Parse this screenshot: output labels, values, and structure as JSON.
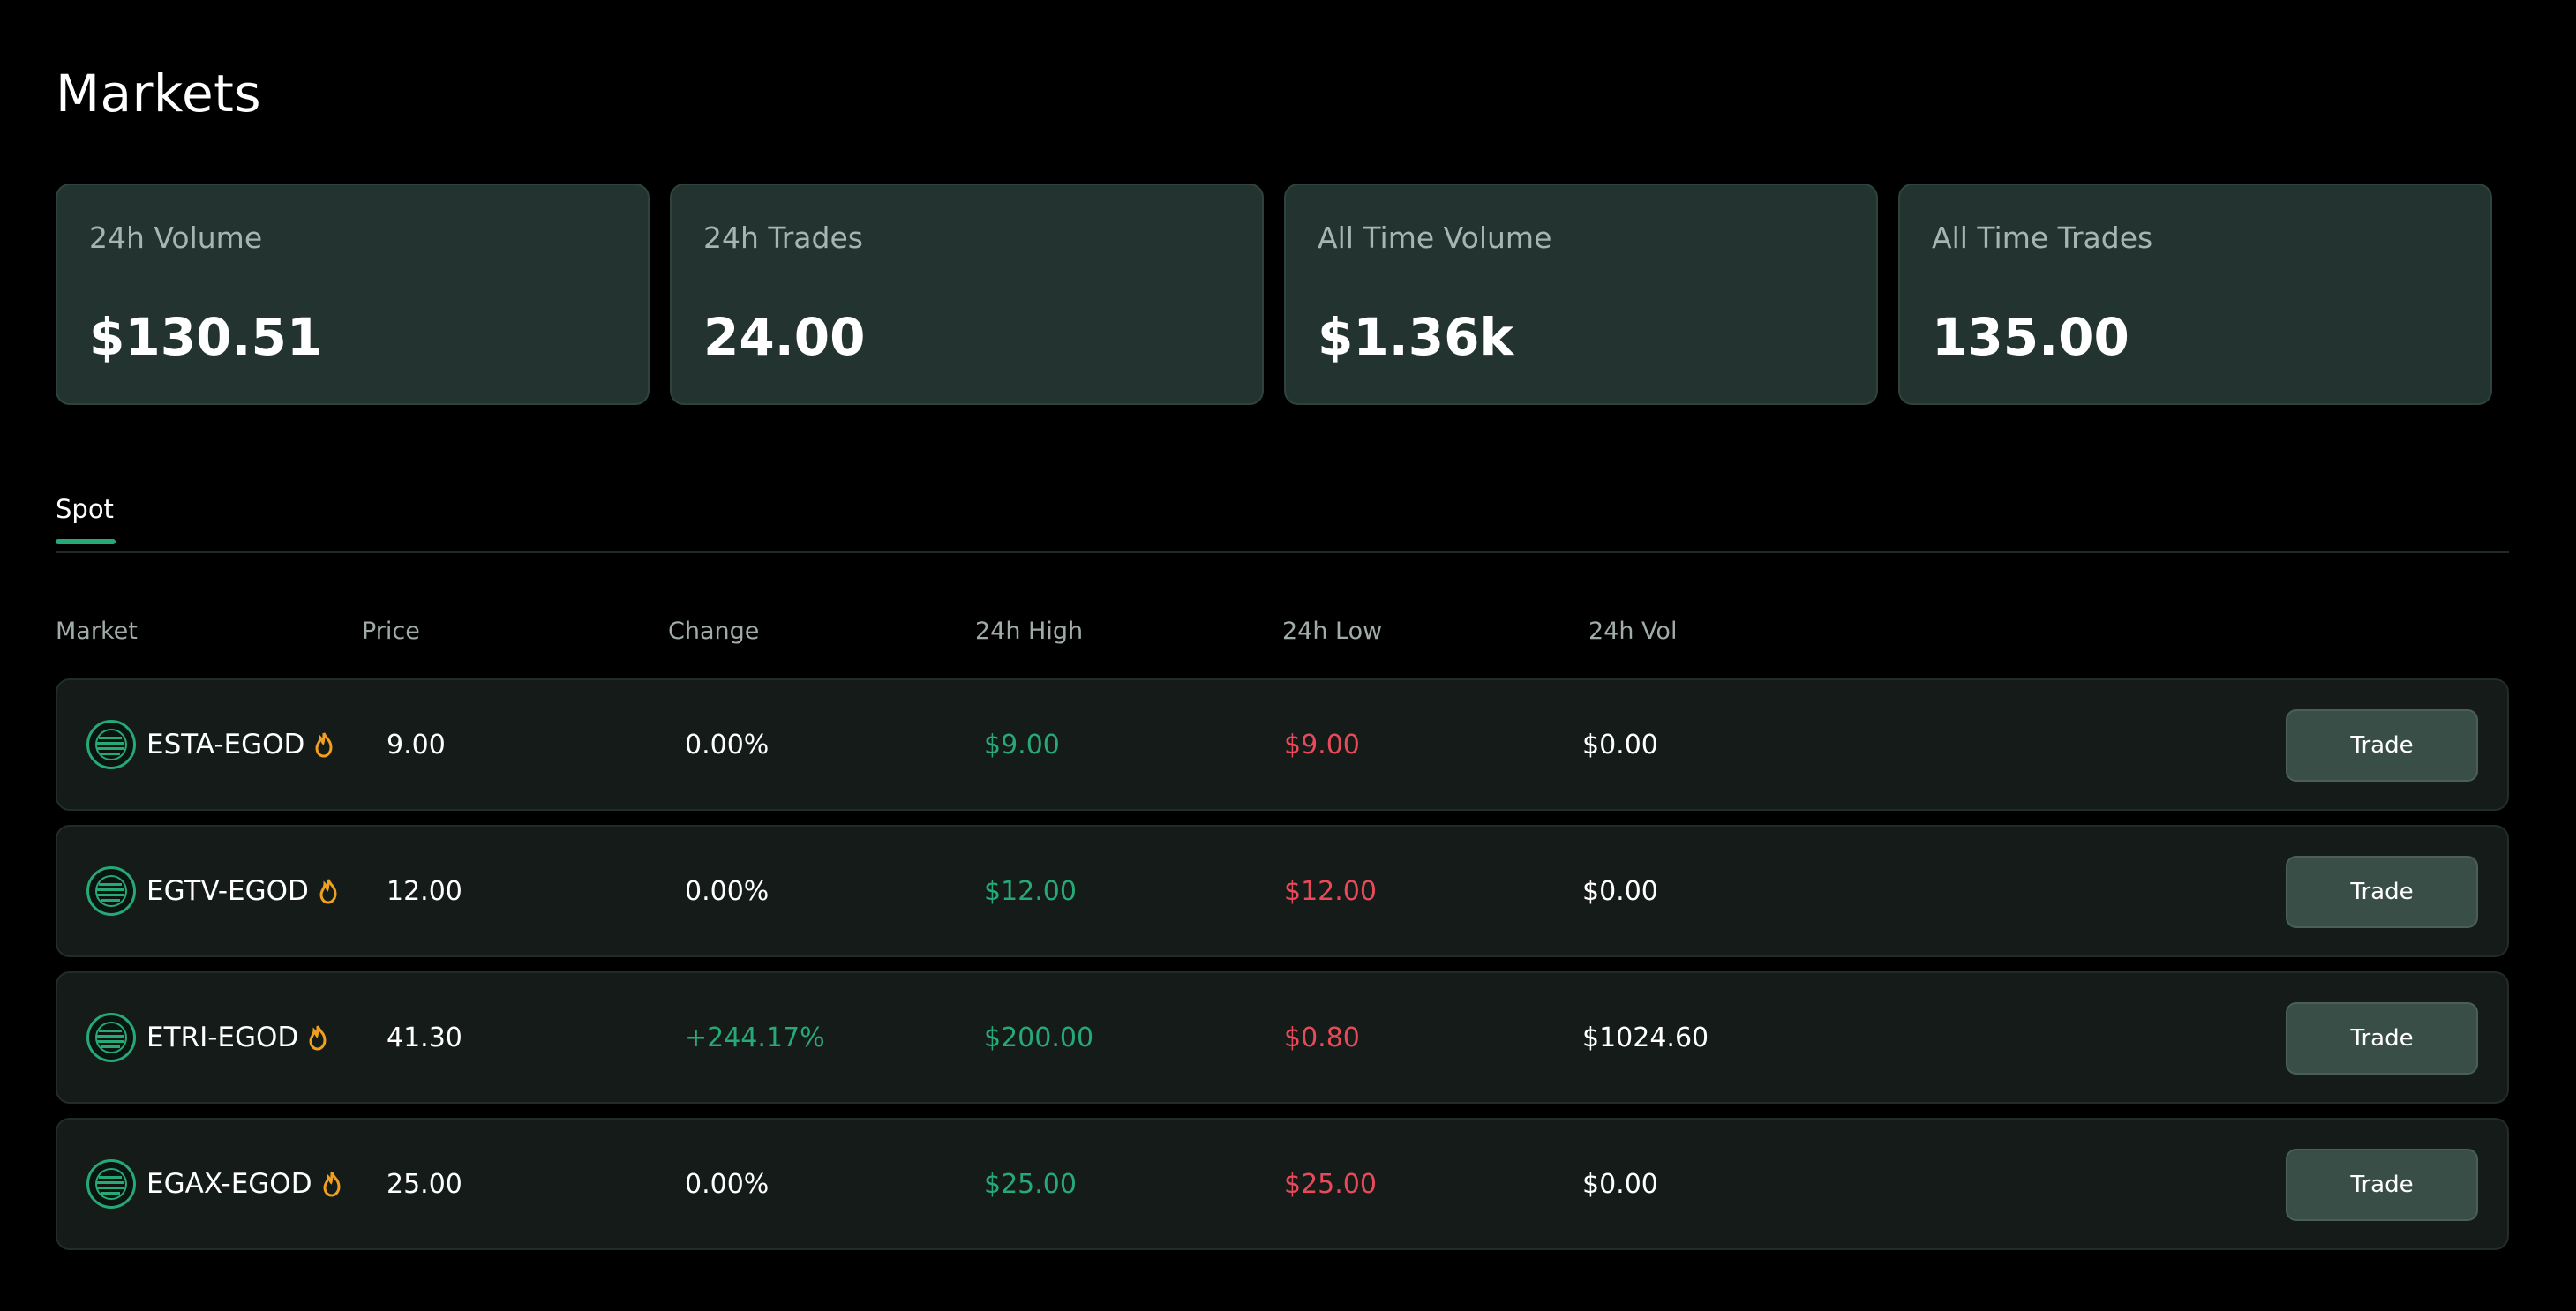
{
  "page": {
    "title": "Markets"
  },
  "stats": [
    {
      "label": "24h Volume",
      "value": "$130.51"
    },
    {
      "label": "24h Trades",
      "value": "24.00"
    },
    {
      "label": "All Time Volume",
      "value": "$1.36k"
    },
    {
      "label": "All Time Trades",
      "value": "135.00"
    }
  ],
  "tabs": {
    "active": "Spot"
  },
  "table": {
    "headers": {
      "market": "Market",
      "price": "Price",
      "change": "Change",
      "high": "24h High",
      "low": "24h Low",
      "vol": "24h Vol"
    },
    "rows": [
      {
        "market": "ESTA-EGOD",
        "price": "9.00",
        "change": "0.00%",
        "high": "$9.00",
        "low": "$9.00",
        "vol": "$0.00",
        "trade": "Trade"
      },
      {
        "market": "EGTV-EGOD",
        "price": "12.00",
        "change": "0.00%",
        "high": "$12.00",
        "low": "$12.00",
        "vol": "$0.00",
        "trade": "Trade"
      },
      {
        "market": "ETRI-EGOD",
        "price": "41.30",
        "change": "+244.17%",
        "high": "$200.00",
        "low": "$0.80",
        "vol": "$1024.60",
        "trade": "Trade"
      },
      {
        "market": "EGAX-EGOD",
        "price": "25.00",
        "change": "0.00%",
        "high": "$25.00",
        "low": "$25.00",
        "vol": "$0.00",
        "trade": "Trade"
      }
    ]
  },
  "icons": {
    "coin": "coin-logo-icon",
    "hot": "fire-icon"
  },
  "colors": {
    "accent": "#27a877",
    "positive": "#27a877",
    "negative": "#e94a5a",
    "card_bg": "#233430",
    "row_bg": "#141b19",
    "button_bg": "#3a4e48"
  }
}
